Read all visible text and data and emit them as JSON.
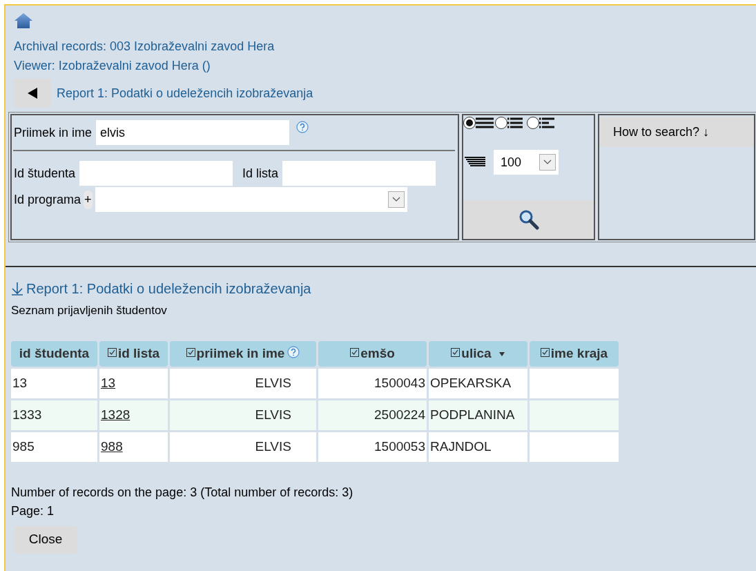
{
  "header": {
    "archival": "Archival records: 003 Izobraževalni zavod Hera",
    "viewer": "Viewer: Izobraževalni zavod Hera ()",
    "report_title": "Report 1: Podatki o udeležencih izobraževanja"
  },
  "search": {
    "fields": [
      {
        "label": "Priimek in ime",
        "value": "elvis",
        "help": true
      },
      {
        "label": "Id študenta"
      },
      {
        "label": "Id lista"
      },
      {
        "label": "Id programa",
        "plus": "+",
        "dropdown": true
      }
    ],
    "views": [
      {
        "selected": true
      },
      {
        "selected": false
      },
      {
        "selected": false
      }
    ],
    "page_size": "100",
    "how_to": "How to search? ↓"
  },
  "results": {
    "title": "Report 1: Podatki o udeležencih izobraževanja",
    "subtitle": "Seznam prijavljenih študentov",
    "columns": [
      {
        "label": "id študenta",
        "checkbox": false,
        "help": false,
        "sorted": false
      },
      {
        "label": "id lista",
        "checkbox": true,
        "help": false,
        "sorted": false
      },
      {
        "label": "priimek in ime",
        "checkbox": true,
        "help": true,
        "sorted": false
      },
      {
        "label": "emšo",
        "checkbox": true,
        "help": false,
        "sorted": false
      },
      {
        "label": "ulica",
        "checkbox": true,
        "help": false,
        "sorted": true
      },
      {
        "label": "ime kraja",
        "checkbox": true,
        "help": false,
        "sorted": false
      }
    ],
    "rows": [
      {
        "cells": [
          "13",
          "13",
          "ELVIS",
          "1500043",
          "OPEKARSKA",
          ""
        ],
        "highlighted": false
      },
      {
        "cells": [
          "1333",
          "1328",
          "ELVIS",
          "2500224",
          "PODPLANINA",
          ""
        ],
        "highlighted": true
      },
      {
        "cells": [
          "985",
          "988",
          "ELVIS",
          "1500053",
          "RAJNDOL",
          ""
        ],
        "highlighted": false
      }
    ],
    "count": "Number of records on the page: 3 (Total number of records: 3)",
    "page": "Page: 1",
    "close": "Close"
  }
}
